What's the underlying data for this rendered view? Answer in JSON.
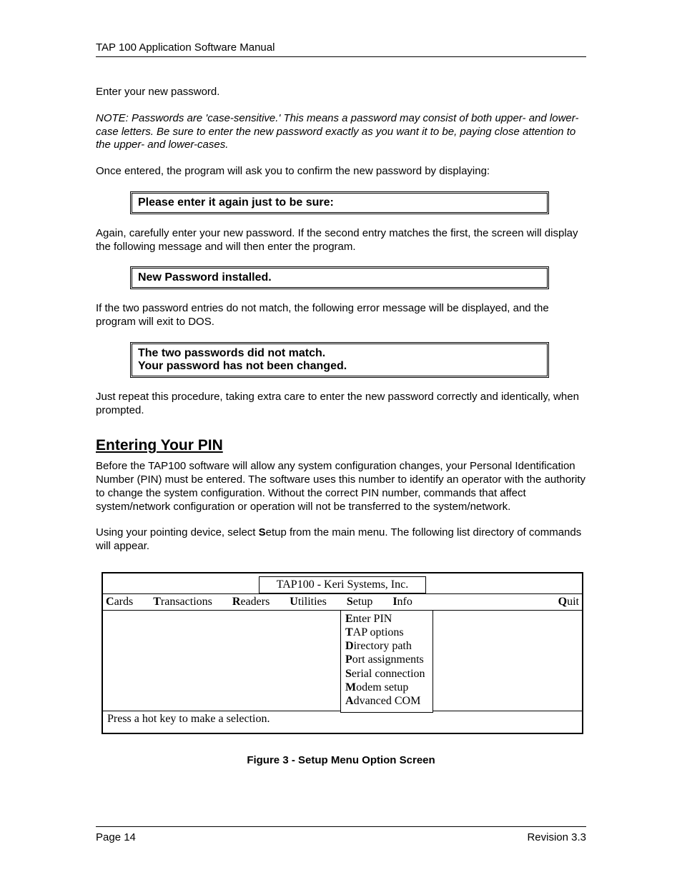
{
  "header": {
    "title": "TAP 100 Application Software Manual"
  },
  "body": {
    "p1": "Enter your new password.",
    "note": "NOTE: Passwords are 'case-sensitive.' This means a password may consist of both upper- and lower-case letters. Be sure to enter the new password exactly as you want it to be, paying close attention to the upper- and lower-cases.",
    "p2": "Once entered, the program will ask you to confirm the new password by displaying:",
    "prompt1": "Please enter it again just to be sure:",
    "p3": "Again, carefully enter your new password. If the second entry matches the first, the screen will display the following message and will then enter the program.",
    "prompt2": "New Password installed.",
    "p4": "If the two password entries do not match, the following error message will be displayed, and the program will exit to DOS.",
    "prompt3_line1": "The two passwords did not match.",
    "prompt3_line2": "Your password has not been changed.",
    "p5": "Just repeat this procedure, taking extra care to enter the new password correctly and identically, when prompted.",
    "heading": "Entering Your PIN",
    "p6": "Before the TAP100 software will allow any system configuration changes, your Personal Identification Number (PIN) must be entered. The software uses this number to identify an operator with the authority to change the system configuration. Without the correct PIN number, commands that affect system/network configuration or operation will not be transferred to the system/network.",
    "p7a": "Using your pointing device, select ",
    "p7b_hotkey": "S",
    "p7b_rest": "etup",
    "p7c": " from the main menu. The following list directory of commands will appear."
  },
  "app": {
    "title": "TAP100 - Keri Systems, Inc.",
    "menu": {
      "cards": {
        "hk": "C",
        "rest": "ards"
      },
      "transactions": {
        "hk": "T",
        "rest": "ransactions"
      },
      "readers": {
        "hk": "R",
        "rest": "eaders"
      },
      "utilities": {
        "hk": "U",
        "rest": "tilities"
      },
      "setup": {
        "hk": "S",
        "rest": "etup"
      },
      "info": {
        "hk": "I",
        "rest": "nfo"
      },
      "quit": {
        "hk": "Q",
        "rest": "uit"
      }
    },
    "dropdown": {
      "enter_pin": {
        "hk": "E",
        "rest": "nter PIN"
      },
      "tap_options": {
        "hk": "T",
        "rest": "AP  options"
      },
      "directory_path": {
        "hk": "D",
        "rest": "irectory path"
      },
      "port_assignments": {
        "hk": "P",
        "rest": "ort assignments"
      },
      "serial_connection": {
        "hk": "S",
        "rest": "erial connection"
      },
      "modem_setup": {
        "hk": "M",
        "rest": "odem setup"
      },
      "advanced_com": {
        "hk": "A",
        "rest": "dvanced COM"
      }
    },
    "status": "Press a hot key to make a selection."
  },
  "figure_caption": "Figure 3 - Setup Menu Option Screen",
  "footer": {
    "page": "Page 14",
    "revision": "Revision 3.3"
  }
}
